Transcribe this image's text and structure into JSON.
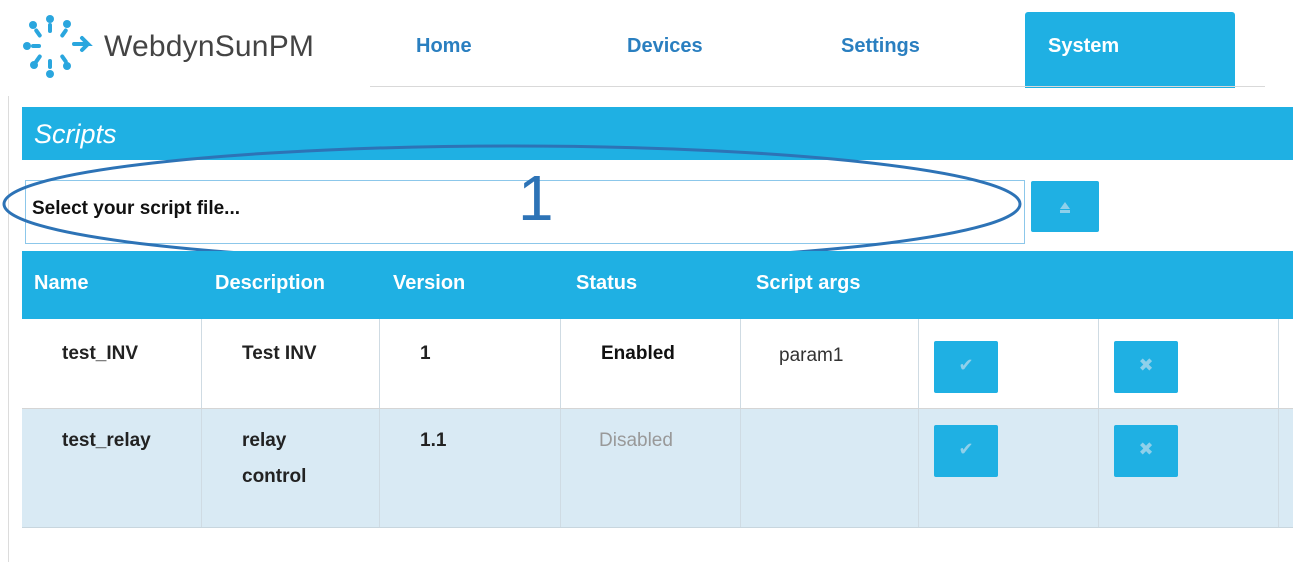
{
  "app": {
    "name": "WebdynSunPM"
  },
  "nav": {
    "tabs": [
      {
        "label": "Home",
        "active": false
      },
      {
        "label": "Devices",
        "active": false
      },
      {
        "label": "Settings",
        "active": false
      },
      {
        "label": "System",
        "active": true
      }
    ]
  },
  "section": {
    "title": "Scripts"
  },
  "upload": {
    "file_label": "Select your script file...",
    "button_icon": "upload-icon",
    "annotation": "1"
  },
  "table": {
    "headers": [
      "Name",
      "Description",
      "Version",
      "Status",
      "Script args"
    ],
    "rows": [
      {
        "name": "test_INV",
        "description": "Test INV",
        "version": "1",
        "status": "Enabled",
        "args": "param1",
        "enable_icon": "check-icon",
        "delete_icon": "close-icon"
      },
      {
        "name": "test_relay",
        "description_line1": "relay",
        "description_line2": "control",
        "version": "1.1",
        "status": "Disabled",
        "args": "",
        "enable_icon": "check-icon",
        "delete_icon": "close-icon"
      }
    ]
  },
  "colors": {
    "accent": "#1fb0e3",
    "link": "#2a7fc0",
    "annotation": "#2d73b6",
    "row_alt": "#d9eaf4"
  }
}
